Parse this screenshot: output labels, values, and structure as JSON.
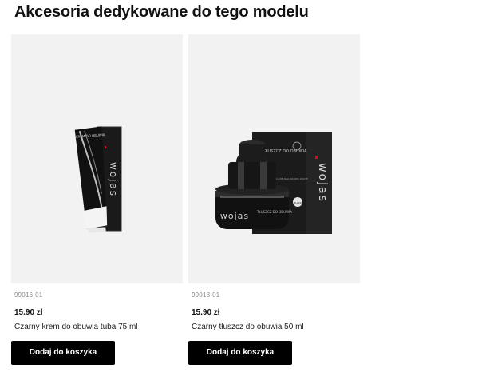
{
  "section": {
    "title": "Akcesoria dedykowane do tego modelu"
  },
  "products": [
    {
      "sku": "99016-01",
      "price": "15.90 zł",
      "name": "Czarny krem do obuwia tuba 75 ml",
      "button_label": "Dodaj do koszyka",
      "image": {
        "brand": "wojas",
        "tube_text": "KREM DO OBUWIA"
      }
    },
    {
      "sku": "99018-01",
      "price": "15.90 zł",
      "name": "Czarny tłuszcz do obuwia 50 ml",
      "button_label": "Dodaj do koszyka",
      "image": {
        "brand": "wojas",
        "box_title": "TŁUSZCZ DO OBUWIA",
        "box_subtitle": "IMPREGNACJA OBUWIA ŚRODKI ŻÓŁTE",
        "jar_label": "TŁUSZCZ DO OBUWIA",
        "badge": "BLACK"
      }
    }
  ],
  "colors": {
    "card_background": "#f2f2f2",
    "button_background": "#000000",
    "button_text": "#ffffff",
    "accent_red": "#e30613"
  }
}
